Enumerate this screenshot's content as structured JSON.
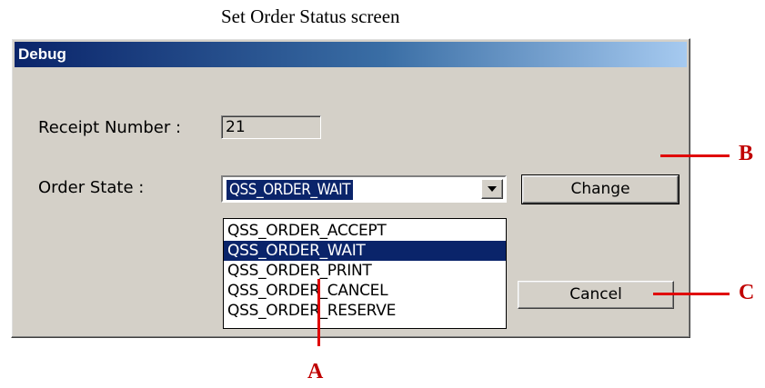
{
  "caption": "Set Order Status screen",
  "dialog": {
    "title": "Debug",
    "receipt_label": "Receipt Number :",
    "receipt_value": "21",
    "state_label": "Order State :",
    "state_selected": "QSS_ORDER_WAIT",
    "state_options": [
      "QSS_ORDER_ACCEPT",
      "QSS_ORDER_WAIT",
      "QSS_ORDER_PRINT",
      "QSS_ORDER_CANCEL",
      "QSS_ORDER_RESERVE"
    ],
    "change_label": "Change",
    "cancel_label": "Cancel"
  },
  "callouts": {
    "a": "A",
    "b": "B",
    "c": "C"
  },
  "colors": {
    "callout": "#e00000",
    "title_start": "#0a246a",
    "title_end": "#a6caf0",
    "dialog_bg": "#d4d0c8",
    "selection": "#0a246a"
  }
}
